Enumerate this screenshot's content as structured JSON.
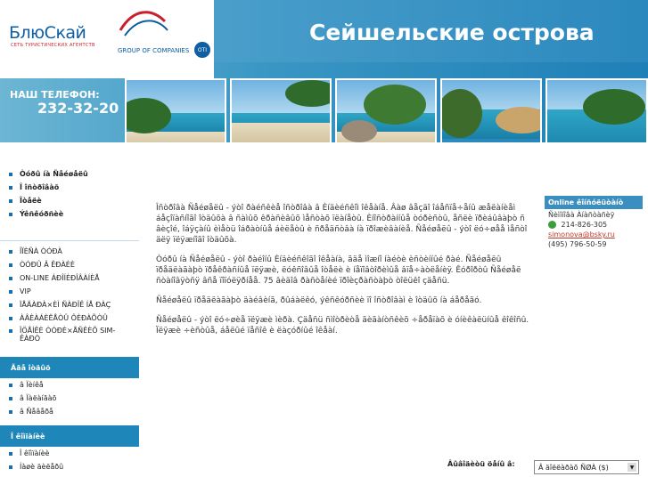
{
  "header": {
    "logo_text": "БлюСкай",
    "logo_subtitle": "СЕТЬ ТУРИСТИЧЕСКИХ АГЕНТСТВ",
    "group_text": "GROUP OF COMPANIES",
    "badge": "OTI",
    "site_title": "Сейшельские острова",
    "phone_label": "НАШ ТЕЛЕФОН:",
    "phone_number": "232-32-20"
  },
  "sidebar": {
    "top_menu": [
      "Òóðû íà Ñåéøåëû",
      "Î îñòðîâàõ",
      "Îòåëè",
      "Ýêñêóðñèè"
    ],
    "second_menu": [
      "ÎÏÈÑÀ ÒÓÐÀ",
      "ÒÓÐÛ Â ÊÐÀÉÈ",
      "ON-LINE ÁÐÎÍÈÐÎÂÀÍÈÅ",
      "VIP",
      "ÏÅÄÀÐÀ×ÈÌ ÑÀÐÎÊ ÍÅ ÐÀÇ",
      "ÀÂÈÀÁÈËÅÒÛ ÔÈÐÀÕÒÛ",
      "ÎÖÅÍÊÈ ÒÓÐÈ×ÅÑÊÈÕ SIM-ÊÀÐÒ"
    ],
    "section_1_title": "Ãäå îòäûõ",
    "section_1_items": [
      "â Ïèíêå",
      "â Ïàëàíãàõ",
      "â Ñåâåðå"
    ],
    "section_2_title": "Î êîìïàíèè",
    "section_2_items": [
      "Î êîìïàíèè",
      "Íàøè äèëåðû"
    ]
  },
  "main": {
    "paragraphs": [
      "Îñòðîâà Ñåéøåëû - ýòî ðàéñêèå îñòðîâà â Èíäèéñêîì îêåàíå. Âàø âåçäî îáåñïå÷åíû æåëàíèåì áåçîïàñíîãî îòäûõà â ñàìûõ êðàñèâûõ ìåñòàõ ïëàíåòû. Èíîñòðàííûå òóðèñòû, åñëè ïðèáûâàþò ñ âèçîé, îáÿçàíû èìåòü îáðàòíûå áèëåòû è ñðåäñòâà íà ïðîæèâàíèå. Ñåéøåëû - ýòî ëó÷øåå ìåñòî äëÿ ïëÿæíîãî îòäûõà.",
      "Òóðû íà Ñåéøåëû - ýòî ðàéîíû Èíäèéñêîãî îêåàíà, ãäå ìîæíî íàéòè èñòèííûé ðàé. Ñåéøåëû ïðåäëàãàþò ïðåêðàñíûå ïëÿæè, ëóêñîâûå îòåëè è íåïîâòîðèìûå âïå÷àòëåíèÿ. Êóðîðòû Ñåéøåë ñòàíîâÿòñÿ âñå ïîïóëÿðíåå. 75 âèäîâ ðàñòåíèé ïðîèçðàñòàþò òîëüêî çäåñü.",
      "Ñåéøåëû ïðåäëàãàþò äàéâèíã, ðûáàëêó, ýêñêóðñèè ïî îñòðîâàì è îòäûõ íà áåðåãó.",
      "Ñåéøåëû - ýòî ëó÷øèå ïëÿæè ìèðà. Çäåñü ñìîòðèòå ãèãàíòñêèõ ÷åðåïàõ è óíèêàëüíûå êîêîñû. Ïëÿæè ÷èñòûå, áåëûé ïåñîê è ëàçóðíûé îêåàí."
    ],
    "online": {
      "title": "Online êîíñóëüòàíò",
      "name": "Ñèìîíîâà Àíàñòàñèÿ",
      "icq": "214-826-305",
      "email": "simonova@bsky.ru",
      "phone": "(495) 796-50-59"
    },
    "currency_label": "Âûâîäèòü öåíû â:",
    "currency_value": "Â äîëëàðàõ ÑØÀ ($)"
  }
}
